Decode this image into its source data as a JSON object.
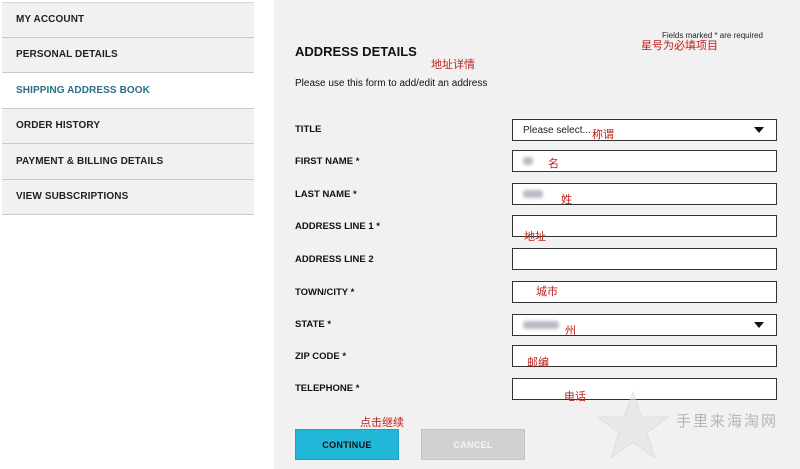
{
  "sidebar": {
    "items": [
      {
        "label": "MY ACCOUNT"
      },
      {
        "label": "PERSONAL DETAILS"
      },
      {
        "label": "SHIPPING ADDRESS BOOK",
        "active": true
      },
      {
        "label": "ORDER HISTORY"
      },
      {
        "label": "PAYMENT & BILLING DETAILS"
      },
      {
        "label": "VIEW SUBSCRIPTIONS"
      }
    ]
  },
  "form": {
    "required_note": "Fields marked * are required",
    "required_note_cn": "星号为必填项目",
    "title": "ADDRESS DETAILS",
    "title_cn": "地址详情",
    "subtitle": "Please use this form to add/edit an address",
    "fields": {
      "title": {
        "label": "TITLE",
        "value": "Please select...",
        "cn": "称谓"
      },
      "first_name": {
        "label": "FIRST NAME *",
        "cn": "名"
      },
      "last_name": {
        "label": "LAST NAME *",
        "cn": "姓"
      },
      "address1": {
        "label": "ADDRESS LINE 1 *",
        "cn": "地址"
      },
      "address2": {
        "label": "ADDRESS LINE 2"
      },
      "town": {
        "label": "TOWN/CITY *",
        "cn": "城市"
      },
      "state": {
        "label": "STATE *",
        "cn": "州"
      },
      "zip": {
        "label": "ZIP CODE *",
        "cn": "邮编"
      },
      "telephone": {
        "label": "TELEPHONE *",
        "cn": "电话"
      }
    },
    "buttons": {
      "continue": "CONTINUE",
      "cancel": "CANCEL",
      "continue_cn": "点击继续"
    }
  },
  "watermark": {
    "text": "手里来海淘网"
  },
  "colors": {
    "accent": "#20b7d8",
    "active_link": "#2a6f86",
    "annotation": "#c0201a",
    "panel_bg": "#f1f1f1"
  }
}
